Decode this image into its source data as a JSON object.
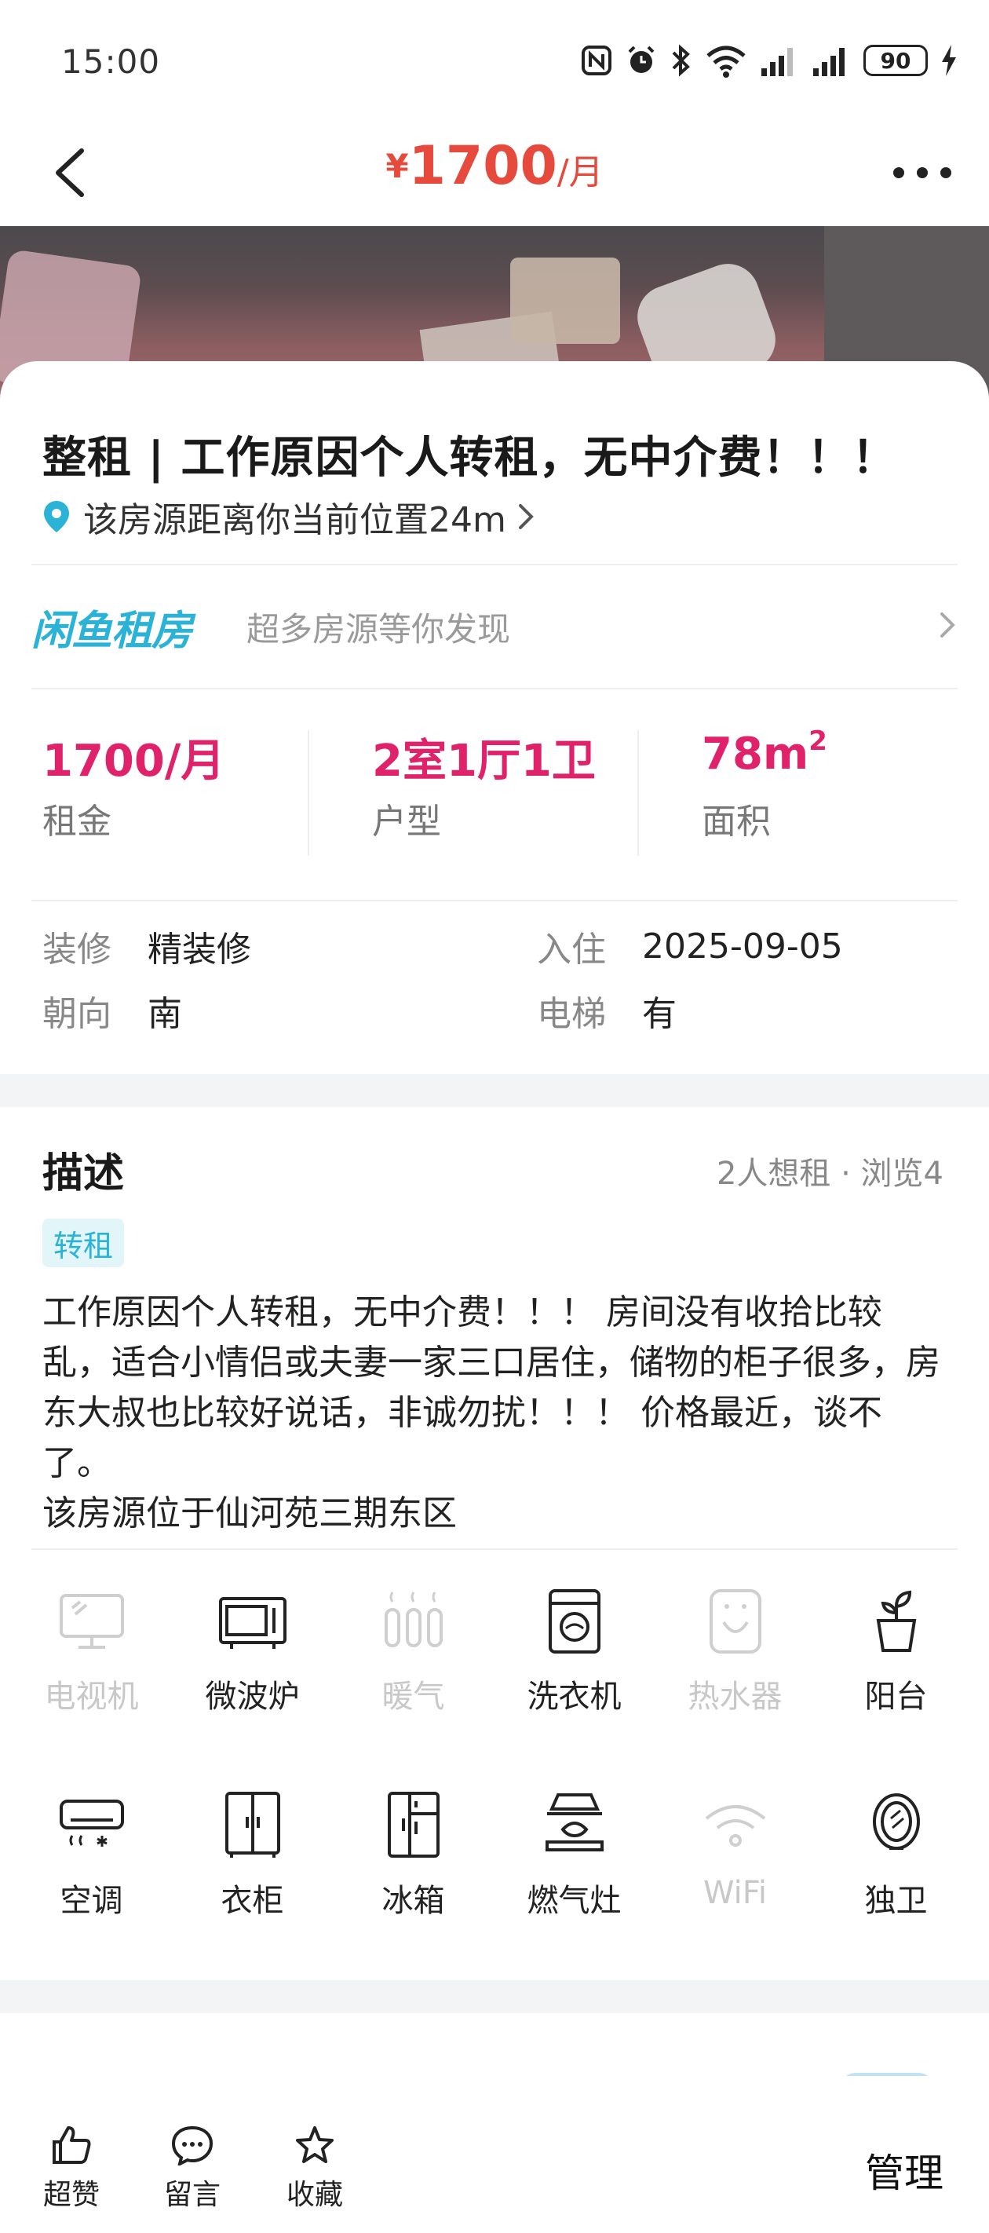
{
  "status_bar": {
    "time": "15:00",
    "battery": "90"
  },
  "nav": {
    "currency": "¥",
    "price": "1700",
    "unit": "/月"
  },
  "listing": {
    "title": "整租 | 工作原因个人转租，无中介费！！！",
    "location": "该房源距离你当前位置24m"
  },
  "promo": {
    "logo": "闲鱼租房",
    "text": "超多房源等你发现"
  },
  "stats": [
    {
      "value": "1700/月",
      "label": "租金"
    },
    {
      "value": "2室1厅1卫",
      "label": "户型"
    },
    {
      "value": "78m",
      "sup": "2",
      "label": "面积"
    }
  ],
  "details": [
    {
      "key": "装修",
      "value": "精装修"
    },
    {
      "key": "入住",
      "value": "2025-09-05"
    },
    {
      "key": "朝向",
      "value": "南"
    },
    {
      "key": "电梯",
      "value": "有"
    }
  ],
  "description": {
    "title": "描述",
    "meta": "2人想租 · 浏览4",
    "tag": "转租",
    "body": "工作原因个人转租，无中介费！！！ 房间没有收拾比较乱，适合小情侣或夫妻一家三口居住，储物的柜子很多，房东大叔也比较好说话，非诚勿扰！！！ 价格最近，谈不了。",
    "address": "该房源位于仙河苑三期东区"
  },
  "amenities": [
    {
      "label": "电视机",
      "icon": "tv-icon",
      "available": false
    },
    {
      "label": "微波炉",
      "icon": "microwave-icon",
      "available": true
    },
    {
      "label": "暖气",
      "icon": "heater-icon",
      "available": false
    },
    {
      "label": "洗衣机",
      "icon": "washing-machine-icon",
      "available": true
    },
    {
      "label": "热水器",
      "icon": "water-heater-icon",
      "available": false
    },
    {
      "label": "阳台",
      "icon": "balcony-plant-icon",
      "available": true
    },
    {
      "label": "空调",
      "icon": "air-conditioner-icon",
      "available": true
    },
    {
      "label": "衣柜",
      "icon": "wardrobe-icon",
      "available": true
    },
    {
      "label": "冰箱",
      "icon": "fridge-icon",
      "available": true
    },
    {
      "label": "燃气灶",
      "icon": "gas-stove-icon",
      "available": true
    },
    {
      "label": "WiFi",
      "icon": "wifi-icon",
      "available": false
    },
    {
      "label": "独卫",
      "icon": "bathroom-mirror-icon",
      "available": true
    }
  ],
  "bottom_bar": {
    "like": "超赞",
    "comment": "留言",
    "favorite": "收藏",
    "manage": "管理"
  },
  "colors": {
    "price_red": "#e64a3d",
    "accent_pink": "#e0226b",
    "brand_blue": "#2bb3d7"
  }
}
